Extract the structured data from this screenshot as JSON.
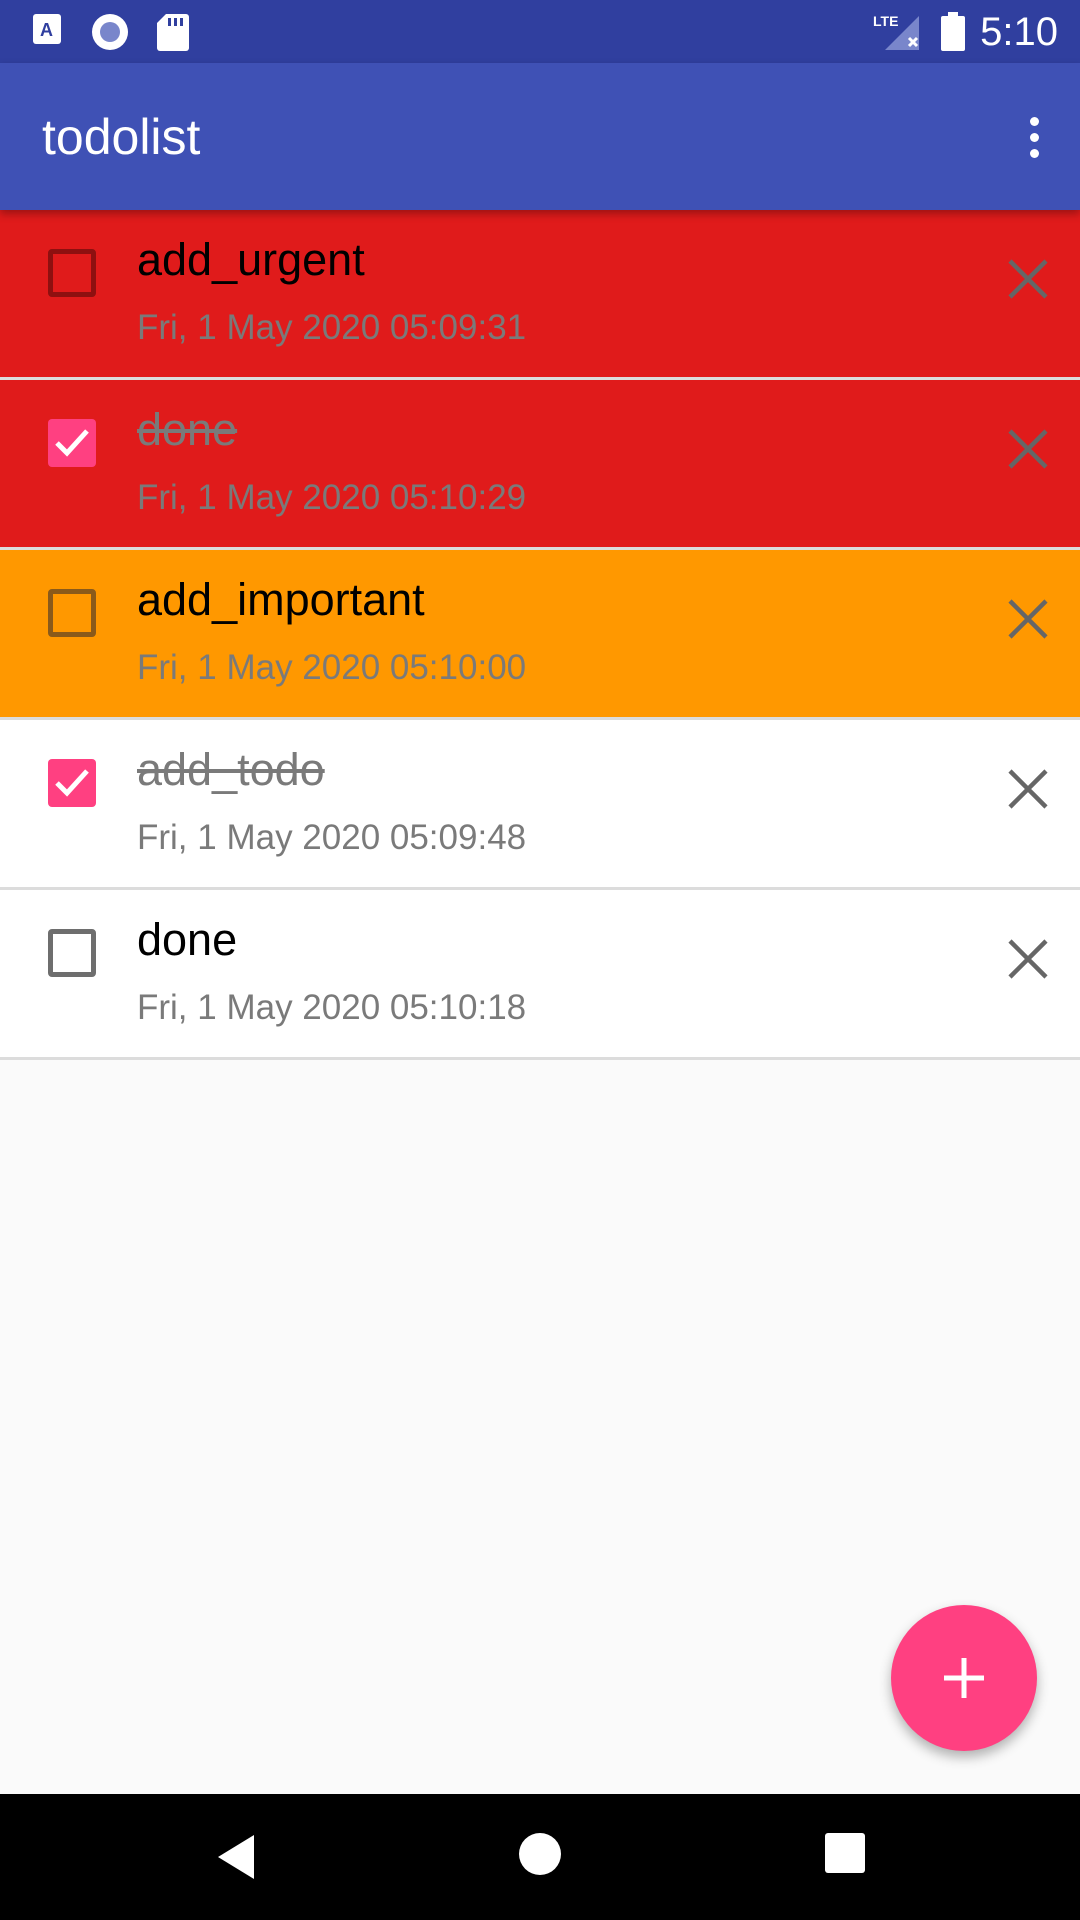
{
  "status_bar": {
    "time": "5:10",
    "left_icons": [
      "a-notification-icon",
      "radio-icon",
      "sd-card-icon"
    ],
    "right_icons": [
      "lte-signal-icon",
      "battery-icon"
    ]
  },
  "app_bar": {
    "title": "todolist",
    "overflow_icon": "more-vert-icon"
  },
  "todos": [
    {
      "title": "add_urgent",
      "date": "Fri, 1 May 2020 05:09:31",
      "checked": false,
      "priority": "urgent",
      "bg": "#e01b1b"
    },
    {
      "title": "done",
      "date": "Fri, 1 May 2020 05:10:29",
      "checked": true,
      "priority": "urgent",
      "bg": "#e01b1b"
    },
    {
      "title": "add_important",
      "date": "Fri, 1 May 2020 05:10:00",
      "checked": false,
      "priority": "important",
      "bg": "#ff9800"
    },
    {
      "title": "add_todo",
      "date": "Fri, 1 May 2020 05:09:48",
      "checked": true,
      "priority": "normal",
      "bg": "#ffffff"
    },
    {
      "title": "done",
      "date": "Fri, 1 May 2020 05:10:18",
      "checked": false,
      "priority": "normal",
      "bg": "#ffffff"
    }
  ],
  "fab": {
    "icon": "plus-icon"
  },
  "colors": {
    "status_bar": "#303f9f",
    "app_bar": "#3f51b5",
    "accent": "#ff4081",
    "urgent": "#e01b1b",
    "important": "#ff9800",
    "background": "#fafafa"
  },
  "nav_bar": [
    "back-icon",
    "home-icon",
    "recents-icon"
  ]
}
